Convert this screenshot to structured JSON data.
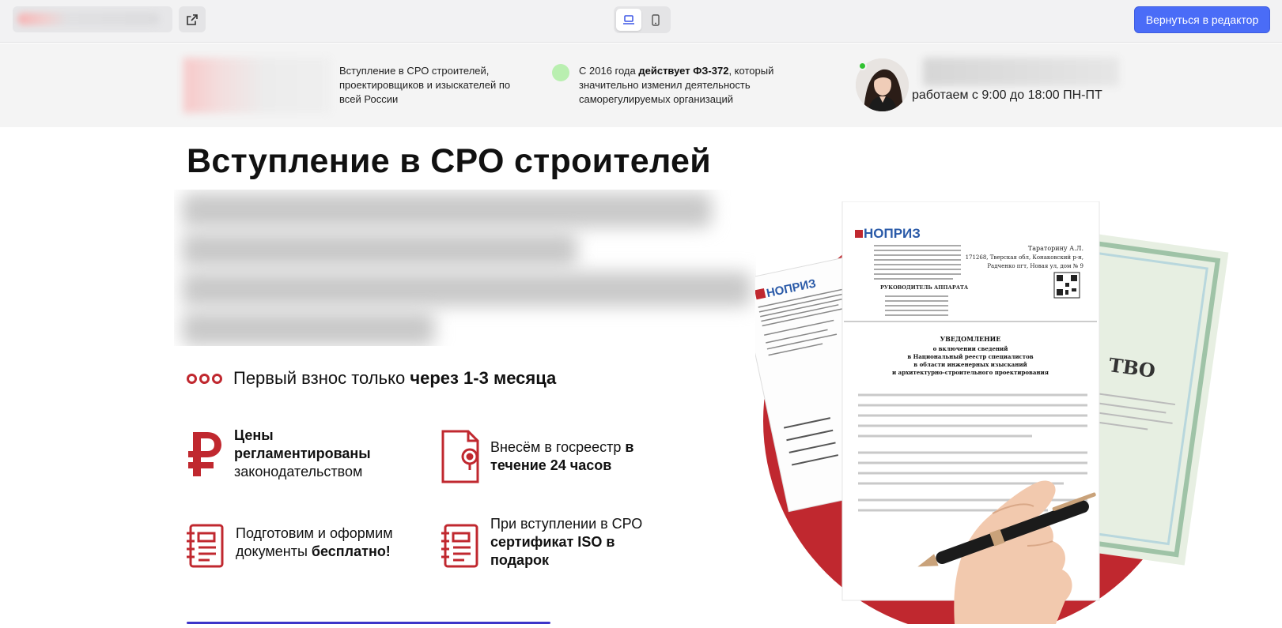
{
  "editor": {
    "back_label": "Вернуться в редактор"
  },
  "header": {
    "tagline": "Вступление в СРО строителей, проектировщиков и изыскателей по всей России",
    "law_prefix": "С 2016 года ",
    "law_bold": "действует ФЗ-372",
    "law_suffix": ", который значительно изменил деятельность саморегулируемых организаций",
    "work_hours": "работаем с 9:00 до 18:00 ПН-ПТ"
  },
  "hero": {
    "title": "Вступление в СРО строителей",
    "first_fee_prefix": "Первый взнос только ",
    "first_fee_bold": "через 1-3 месяца"
  },
  "features": {
    "prices_bold": "Цены регламентированы",
    "prices_rest": "законодательством",
    "registry_prefix": "Внесём в госреестр ",
    "registry_bold": "в течение 24 часов",
    "docs_prefix": "Подготовим и оформим документы ",
    "docs_bold": "бесплатно!",
    "iso_prefix": "При вступлении в СРО ",
    "iso_bold": "сертификат ISO в подарок"
  },
  "documents": {
    "logo": "НОПРИЗ",
    "addressee": "Тараторину А.Л.",
    "address1": "171268, Тверская обл, Конаковский р-н,",
    "address2": "Радченко пгт, Новая ул, дом № 9",
    "signer": "РУКОВОДИТЕЛЬ АППАРАТА",
    "notice_title": "УВЕДОМЛЕНИЕ",
    "notice_line1": "о включении сведений",
    "notice_line2": "в Национальный реестр специалистов",
    "notice_line3": "в области инженерных изысканий",
    "notice_line4": "и архитектурно-строительного проектирования",
    "certificate_word": "ТВО"
  },
  "colors": {
    "accent_red": "#c0282f",
    "button_blue": "#4a6cf7"
  }
}
